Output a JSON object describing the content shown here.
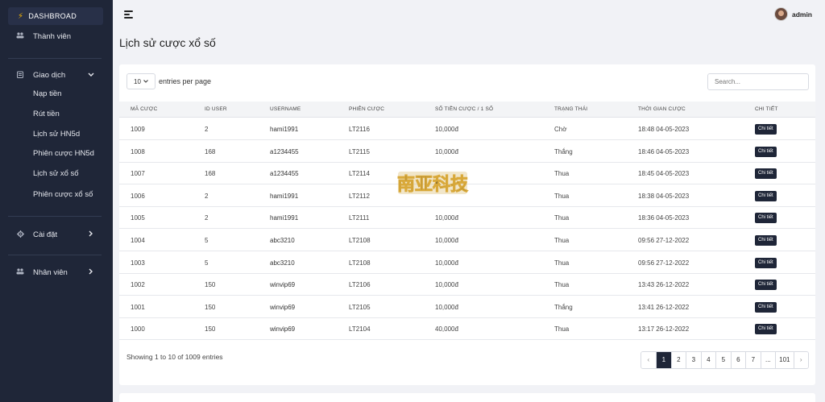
{
  "sidebar": {
    "brand": "DASHBROAD",
    "items": [
      {
        "label": "Thành viên",
        "icon": "users-icon"
      },
      {
        "label": "Giao dịch",
        "icon": "clipboard-icon"
      },
      {
        "label": "Cài đặt",
        "icon": "gear-icon"
      },
      {
        "label": "Nhân viên",
        "icon": "users-icon"
      }
    ],
    "sub_items": [
      "Nạp tiền",
      "Rút tiền",
      "Lịch sử HN5d",
      "Phiên cược HN5d",
      "Lịch sử xổ số",
      "Phiên cược xổ số"
    ]
  },
  "topbar": {
    "username": "admin"
  },
  "page": {
    "title": "Lịch sử cược xổ số"
  },
  "table_controls": {
    "page_length": "10",
    "entries_label": "entries per page",
    "search_placeholder": "Search..."
  },
  "table": {
    "columns": [
      "MÃ CƯỢC",
      "ID USER",
      "USERNAME",
      "PHIÊN CƯỢC",
      "SỐ TIỀN CƯỢC / 1 SỐ",
      "TRẠNG THÁI",
      "THỜI GIAN CƯỢC",
      "CHI TIẾT"
    ],
    "detail_label": "Chi tiết",
    "rows": [
      [
        "1009",
        "2",
        "hami1991",
        "LT2116",
        "10,000đ",
        "Chờ",
        "18:48 04-05-2023"
      ],
      [
        "1008",
        "168",
        "a1234455",
        "LT2115",
        "10,000đ",
        "Thắng",
        "18:46 04-05-2023"
      ],
      [
        "1007",
        "168",
        "a1234455",
        "LT2114",
        "",
        "Thua",
        "18:45 04-05-2023"
      ],
      [
        "1006",
        "2",
        "hami1991",
        "LT2112",
        "",
        "Thua",
        "18:38 04-05-2023"
      ],
      [
        "1005",
        "2",
        "hami1991",
        "LT2111",
        "10,000đ",
        "Thua",
        "18:36 04-05-2023"
      ],
      [
        "1004",
        "5",
        "abc3210",
        "LT2108",
        "10,000đ",
        "Thua",
        "09:56 27-12-2022"
      ],
      [
        "1003",
        "5",
        "abc3210",
        "LT2108",
        "10,000đ",
        "Thua",
        "09:56 27-12-2022"
      ],
      [
        "1002",
        "150",
        "winvip69",
        "LT2106",
        "10,000đ",
        "Thua",
        "13:43 26-12-2022"
      ],
      [
        "1001",
        "150",
        "winvip69",
        "LT2105",
        "10,000đ",
        "Thắng",
        "13:41 26-12-2022"
      ],
      [
        "1000",
        "150",
        "winvip69",
        "LT2104",
        "40,000đ",
        "Thua",
        "13:17 26-12-2022"
      ]
    ]
  },
  "footer": {
    "info": "Showing 1 to 10 of 1009 entries",
    "pages": [
      "‹",
      "1",
      "2",
      "3",
      "4",
      "5",
      "6",
      "7",
      "...",
      "101",
      "›"
    ],
    "active_page": "1"
  },
  "watermark": {
    "text": "南亚科技"
  },
  "colors": {
    "sidebar_bg": "#1f2638",
    "accent": "#f5b400",
    "button_dark": "#1f2638"
  }
}
